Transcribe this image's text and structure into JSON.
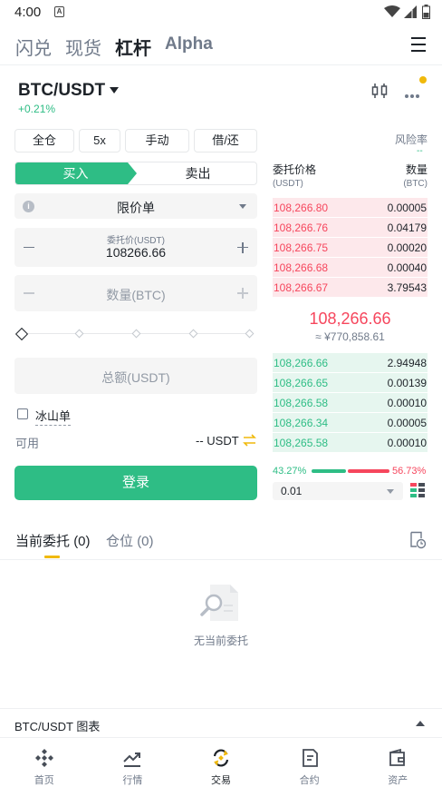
{
  "status": {
    "time": "4:00",
    "sim_label": "A"
  },
  "top_tabs": [
    {
      "label": "闪兑",
      "active": false
    },
    {
      "label": "现货",
      "active": false
    },
    {
      "label": "杠杆",
      "active": true
    },
    {
      "label": "Alpha",
      "active": false
    }
  ],
  "pair": {
    "symbol": "BTC/USDT",
    "change": "+0.21%"
  },
  "controls": {
    "margin_mode": "全仓",
    "leverage": "5x",
    "mode": "手动",
    "borrow_repay": "借/还",
    "risk_label": "风险率",
    "risk_value": "--"
  },
  "side_tabs": {
    "buy": "买入",
    "sell": "卖出"
  },
  "order_form": {
    "order_type": "限价单",
    "price_label": "委托价(USDT)",
    "price_value": "108266.66",
    "qty_placeholder": "数量(BTC)",
    "total_placeholder": "总额(USDT)",
    "iceberg_label": "冰山单",
    "available_label": "可用",
    "available_value": "-- USDT",
    "login_label": "登录"
  },
  "order_book": {
    "price_header": "委托价格",
    "price_unit": "(USDT)",
    "qty_header": "数量",
    "qty_unit": "(BTC)",
    "asks": [
      {
        "price": "108,266.80",
        "qty": "0.00005"
      },
      {
        "price": "108,266.76",
        "qty": "0.04179"
      },
      {
        "price": "108,266.75",
        "qty": "0.00020"
      },
      {
        "price": "108,266.68",
        "qty": "0.00040"
      },
      {
        "price": "108,266.67",
        "qty": "3.79543"
      }
    ],
    "last_price": "108,266.66",
    "last_price_cny": "≈ ¥770,858.61",
    "bids": [
      {
        "price": "108,266.66",
        "qty": "2.94948"
      },
      {
        "price": "108,266.65",
        "qty": "0.00139"
      },
      {
        "price": "108,266.58",
        "qty": "0.00010"
      },
      {
        "price": "108,266.34",
        "qty": "0.00005"
      },
      {
        "price": "108,265.58",
        "qty": "0.00010"
      }
    ],
    "buy_ratio": "43.27%",
    "sell_ratio": "56.73%",
    "precision": "0.01"
  },
  "orders": {
    "open_tab": "当前委托",
    "open_count": "(0)",
    "positions_tab": "仓位",
    "positions_count": "(0)",
    "empty_text": "无当前委托"
  },
  "chart_bar": {
    "label": "BTC/USDT 图表"
  },
  "bottom_nav": [
    {
      "label": "首页",
      "icon": "home-icon",
      "active": false
    },
    {
      "label": "行情",
      "icon": "markets-icon",
      "active": false
    },
    {
      "label": "交易",
      "icon": "trade-icon",
      "active": true
    },
    {
      "label": "合约",
      "icon": "futures-icon",
      "active": false
    },
    {
      "label": "资产",
      "icon": "wallet-icon",
      "active": false
    }
  ],
  "colors": {
    "green": "#2ebd85",
    "red": "#f6465d",
    "accent": "#f0b90b",
    "text": "#1e2329",
    "muted": "#707a8a"
  }
}
